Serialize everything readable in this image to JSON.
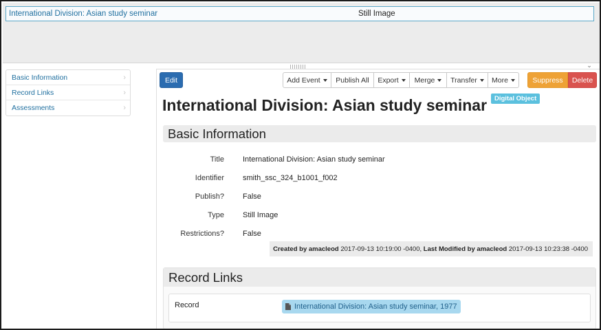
{
  "tree": {
    "row_title": "International Division: Asian study seminar",
    "row_type": "Still Image"
  },
  "sidebar": {
    "items": [
      {
        "label": "Basic Information"
      },
      {
        "label": "Record Links"
      },
      {
        "label": "Assessments"
      }
    ]
  },
  "toolbar": {
    "edit_label": "Edit",
    "add_event_label": "Add Event",
    "publish_all_label": "Publish All",
    "export_label": "Export",
    "merge_label": "Merge",
    "transfer_label": "Transfer",
    "more_label": "More",
    "suppress_label": "Suppress",
    "delete_label": "Delete"
  },
  "record": {
    "title": "International Division: Asian study seminar",
    "badge": "Digital Object"
  },
  "basic_info": {
    "header": "Basic Information",
    "fields": [
      {
        "label": "Title",
        "value": "International Division: Asian study seminar"
      },
      {
        "label": "Identifier",
        "value": "smith_ssc_324_b1001_f002"
      },
      {
        "label": "Publish?",
        "value": "False"
      },
      {
        "label": "Type",
        "value": "Still Image"
      },
      {
        "label": "Restrictions?",
        "value": "False"
      }
    ],
    "audit": {
      "created_label": "Created by",
      "created_by": "amacleod",
      "created_at": "2017-09-13 10:19:00 -0400,",
      "modified_label": "Last Modified by",
      "modified_by": "amacleod",
      "modified_at": "2017-09-13 10:23:38 -0400"
    }
  },
  "record_links": {
    "header": "Record Links",
    "label": "Record",
    "link_text": "International Division: Asian study seminar, 1977"
  },
  "colors": {
    "primary": "#2b6cb0",
    "warning": "#eea236",
    "danger": "#d9534f",
    "info": "#5bc0de",
    "link": "#1f6f9f"
  }
}
